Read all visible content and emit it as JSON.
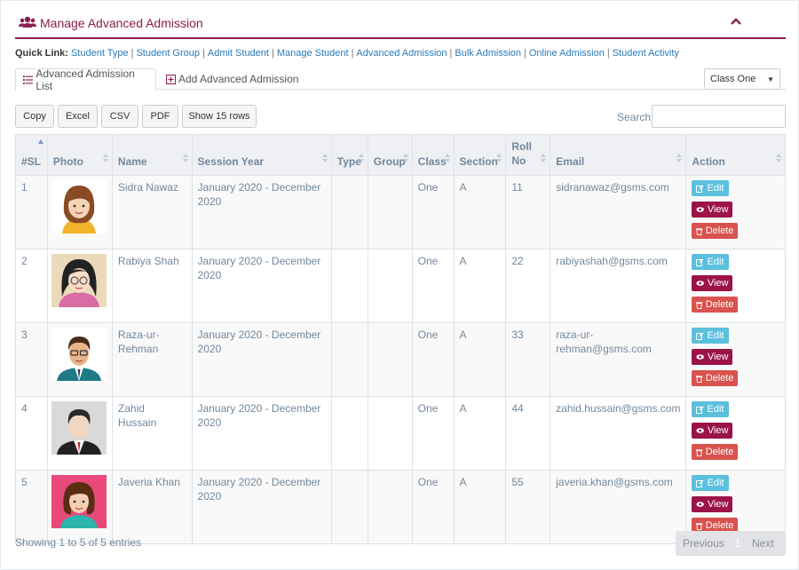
{
  "panel": {
    "title": "Manage Advanced Admission"
  },
  "quick_links": {
    "label": "Quick Link:",
    "items": [
      "Student Type",
      "Student Group",
      "Admit Student",
      "Manage Student",
      "Advanced Admission",
      "Bulk Admission",
      "Online Admission",
      "Student Activity"
    ],
    "separator": "|"
  },
  "tabs": {
    "list_label": "Advanced Admission List",
    "add_label": "Add Advanced Admission"
  },
  "class_filter": {
    "selected": "Class One"
  },
  "toolbar": {
    "copy": "Copy",
    "excel": "Excel",
    "csv": "CSV",
    "pdf": "PDF",
    "rows": "Show 15 rows",
    "search_label": "Search:"
  },
  "table": {
    "headers": [
      "#SL",
      "Photo",
      "Name",
      "Session Year",
      "Type",
      "Group",
      "Class",
      "Section",
      "Roll No",
      "Email",
      "Action"
    ],
    "rows": [
      {
        "sl": "1",
        "name": "Sidra Nawaz",
        "session": "January 2020 - December 2020",
        "type": "",
        "group": "",
        "class": "One",
        "section": "A",
        "roll": "11",
        "email": "sidranawaz@gsms.com",
        "avatar": "woman-orange-icon"
      },
      {
        "sl": "2",
        "name": "Rabiya Shah",
        "session": "January 2020 - December 2020",
        "type": "",
        "group": "",
        "class": "One",
        "section": "A",
        "roll": "22",
        "email": "rabiyashah@gsms.com",
        "avatar": "woman-glasses-icon"
      },
      {
        "sl": "3",
        "name": "Raza-ur-Rehman",
        "session": "January 2020 - December 2020",
        "type": "",
        "group": "",
        "class": "One",
        "section": "A",
        "roll": "33",
        "email": "raza-ur-rehman@gsms.com",
        "avatar": "man-glasses-icon"
      },
      {
        "sl": "4",
        "name": "Zahid Hussain",
        "session": "January 2020 - December 2020",
        "type": "",
        "group": "",
        "class": "One",
        "section": "A",
        "roll": "44",
        "email": "zahid.hussain@gsms.com",
        "avatar": "man-suit-icon"
      },
      {
        "sl": "5",
        "name": "Javeria Khan",
        "session": "January 2020 - December 2020",
        "type": "",
        "group": "",
        "class": "One",
        "section": "A",
        "roll": "55",
        "email": "javeria.khan@gsms.com",
        "avatar": "girl-pink-icon"
      }
    ],
    "actions": {
      "edit": "Edit",
      "view": "View",
      "delete": "Delete"
    }
  },
  "footer": {
    "info": "Showing 1 to 5 of 5 entries",
    "previous": "Previous",
    "page": "1",
    "next": "Next"
  },
  "colors": {
    "brand": "#8c1d4f",
    "link": "#2a7ab8",
    "edit": "#5bc0de",
    "view": "#9b1347",
    "delete": "#d9534f"
  }
}
